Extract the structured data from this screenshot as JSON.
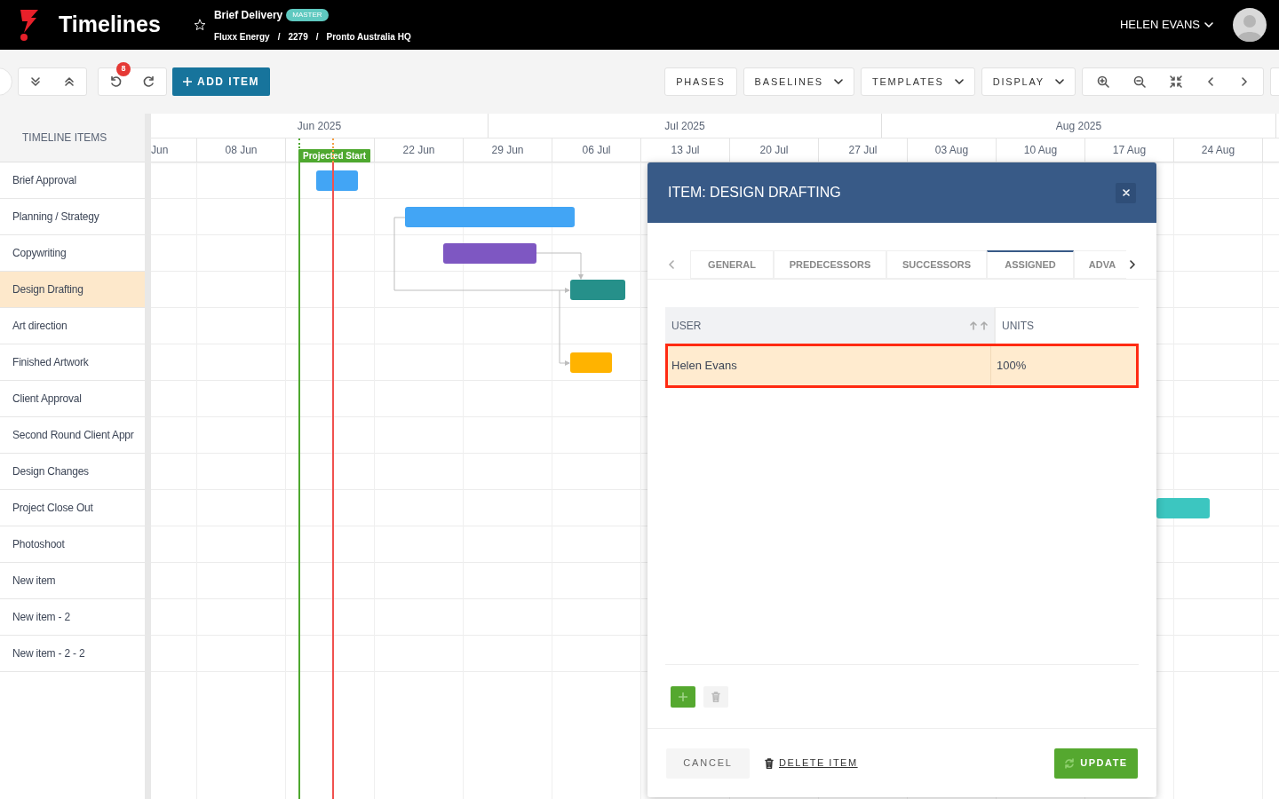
{
  "header": {
    "app_title": "Timelines",
    "project": {
      "title": "Brief Delivery",
      "badge": "MASTER"
    },
    "breadcrumbs": [
      "Fluxx Energy",
      "2279",
      "Pronto Australia HQ"
    ],
    "separator": "/",
    "user_name": "HELEN EVANS"
  },
  "toolbar": {
    "undo_count": "8",
    "add_button": "ADD ITEM",
    "menus": [
      {
        "label": "PHASES",
        "kind": "button"
      },
      {
        "label": "BASELINES",
        "kind": "dropdown"
      },
      {
        "label": "TEMPLATES",
        "kind": "dropdown"
      },
      {
        "label": "DISPLAY",
        "kind": "dropdown"
      }
    ]
  },
  "timeline": {
    "column_header": "TIMELINE ITEMS",
    "months": [
      "Jun 2025",
      "Jul 2025",
      "Aug 2025"
    ],
    "weeks": [
      {
        "kind": "week",
        "label": "Jun"
      },
      {
        "kind": "week",
        "label": "08 Jun"
      },
      {
        "kind": "covered"
      },
      {
        "kind": "week",
        "label": "22 Jun"
      },
      {
        "kind": "week",
        "label": "29 Jun"
      },
      {
        "kind": "week",
        "label": "06 Jul"
      },
      {
        "kind": "week",
        "label": "13 Jul"
      },
      {
        "kind": "week",
        "label": "20 Jul"
      },
      {
        "kind": "week",
        "label": "27 Jul"
      },
      {
        "kind": "week",
        "label": "03 Aug"
      },
      {
        "kind": "week",
        "label": "10 Aug"
      },
      {
        "kind": "week",
        "label": "17 Aug"
      },
      {
        "kind": "week",
        "label": "24 Aug"
      }
    ],
    "markers": [
      {
        "kind": "projected_start",
        "label": "Projected Start",
        "color": "#4ea82f"
      },
      {
        "kind": "today",
        "color": "#f0524f"
      }
    ],
    "rows": [
      {
        "name": "Brief Approval",
        "selected": false,
        "color": "#42a5f5"
      },
      {
        "name": "Planning / Strategy",
        "selected": false,
        "color": "#42a5f5"
      },
      {
        "name": "Copywriting",
        "selected": false,
        "color": "#7e57c2"
      },
      {
        "name": "Design Drafting",
        "selected": true,
        "color": "#26908a"
      },
      {
        "name": "Art direction",
        "selected": false
      },
      {
        "name": "Finished Artwork",
        "selected": false,
        "color": "#ffb300"
      },
      {
        "name": "Client Approval",
        "selected": false
      },
      {
        "name": "Second Round Client Appr",
        "selected": false
      },
      {
        "name": "Design Changes",
        "selected": false
      },
      {
        "name": "Project Close Out",
        "selected": false,
        "color": "#3cc6c0"
      },
      {
        "name": "Photoshoot",
        "selected": false
      },
      {
        "name": "New item",
        "selected": false
      },
      {
        "name": "New item - 2",
        "selected": false
      },
      {
        "name": "New item - 2 - 2",
        "selected": false
      }
    ]
  },
  "modal": {
    "title": "ITEM: DESIGN DRAFTING",
    "tabs": [
      {
        "label": "GENERAL",
        "selected": false
      },
      {
        "label": "PREDECESSORS",
        "selected": false
      },
      {
        "label": "SUCCESSORS",
        "selected": false
      },
      {
        "label": "ASSIGNED",
        "selected": true
      },
      {
        "label": "ADVA",
        "selected": false
      }
    ],
    "table": {
      "columns": [
        "USER",
        "UNITS"
      ],
      "rows": [
        {
          "user": "Helen Evans",
          "units": "100%",
          "selected": true
        }
      ]
    },
    "cancel": "CANCEL",
    "delete": "DELETE ITEM",
    "update": "UPDATE"
  }
}
